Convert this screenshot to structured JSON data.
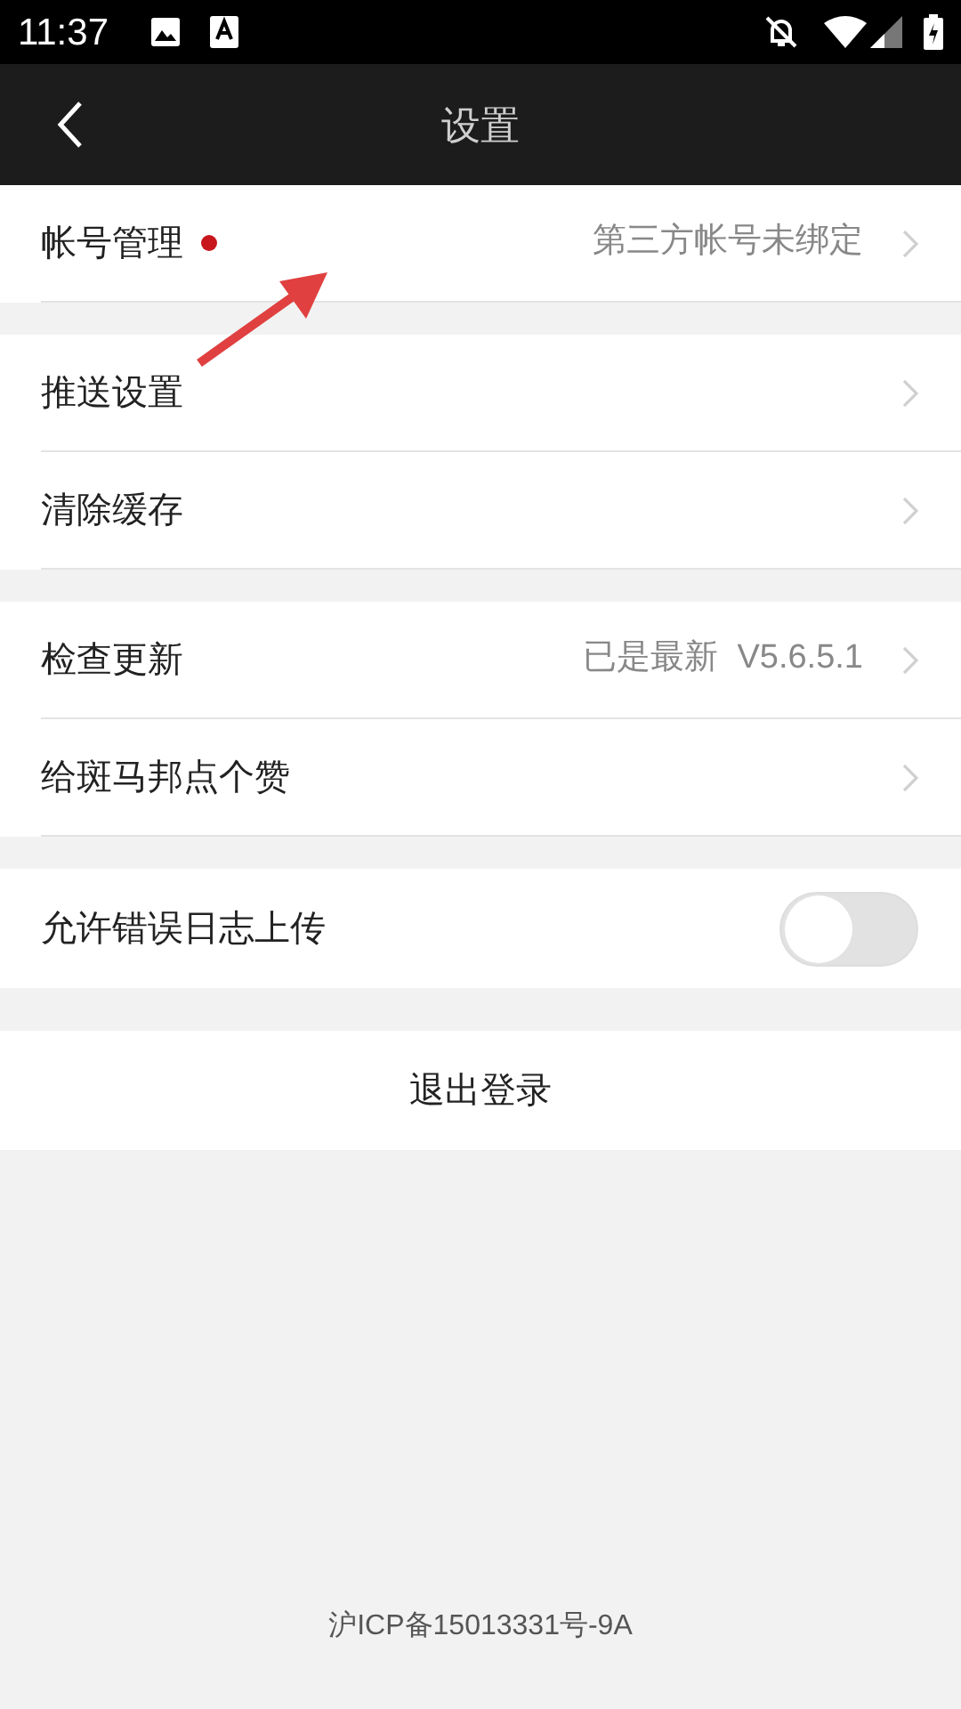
{
  "status_bar": {
    "time": "11:37"
  },
  "app_bar": {
    "title": "设置"
  },
  "sections": [
    {
      "items": [
        {
          "kind": "link",
          "label": "帐号管理",
          "badge": true,
          "value": "第三方帐号未绑定"
        }
      ]
    },
    {
      "items": [
        {
          "kind": "link",
          "label": "推送设置",
          "badge": false
        },
        {
          "kind": "link",
          "label": "清除缓存",
          "badge": false
        }
      ]
    },
    {
      "items": [
        {
          "kind": "link",
          "label": "检查更新",
          "badge": false,
          "value": "已是最新  V5.6.5.1"
        },
        {
          "kind": "link",
          "label": "给斑马邦点个赞",
          "badge": false
        }
      ]
    },
    {
      "items": [
        {
          "kind": "toggle",
          "label": "允许错误日志上传",
          "on": false
        }
      ]
    }
  ],
  "logout_button": "退出登录",
  "footer": "沪ICP备15013331号-9A"
}
